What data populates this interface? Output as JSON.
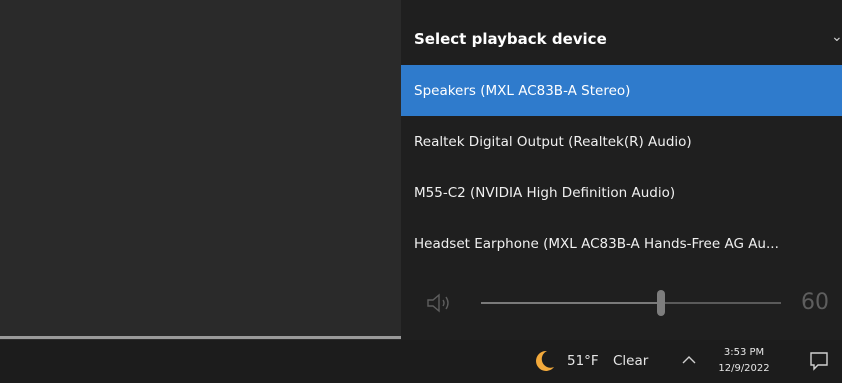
{
  "flyout": {
    "title": "Select playback device",
    "devices": [
      {
        "label": "Speakers (MXL AC83B-A Stereo)",
        "selected": true
      },
      {
        "label": "Realtek Digital Output (Realtek(R) Audio)",
        "selected": false
      },
      {
        "label": "M55-C2 (NVIDIA High Definition Audio)",
        "selected": false
      },
      {
        "label": "Headset Earphone (MXL AC83B-A Hands-Free AG Au...",
        "selected": false
      }
    ],
    "volume": {
      "value": "60",
      "level": 0.6
    }
  },
  "taskbar": {
    "weather": {
      "temperature": "51°F",
      "condition": "Clear"
    },
    "clock": {
      "time": "3:53 PM",
      "date": "12/9/2022"
    }
  },
  "colors": {
    "accent": "#2f7bcc",
    "flyout_bg": "#1f1f1f",
    "taskbar_bg": "#1c1c1c",
    "moon": "#f2a93b"
  },
  "icons": {
    "collapse": "chevron-down-icon",
    "speaker": "speaker-icon",
    "weather": "moon-icon",
    "tray": "chevron-up-icon",
    "notifications": "notification-icon"
  }
}
